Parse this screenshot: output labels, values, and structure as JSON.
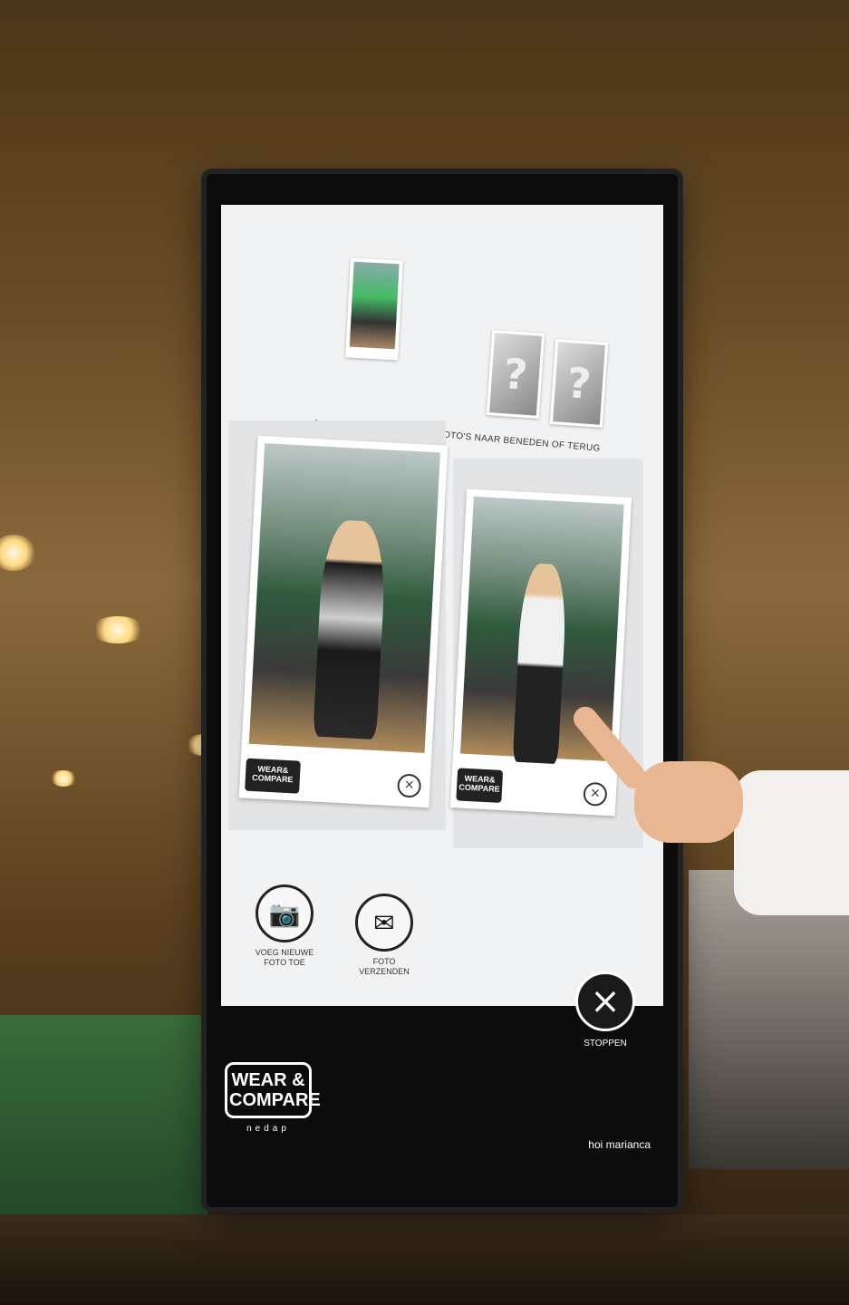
{
  "kiosk": {
    "instruction": "SLEEP MET JE VINGER DE FOTO'S NAAR BENEDEN OF TERUG",
    "actions": [
      {
        "label_line1": "VOEG NIEUWE",
        "label_line2": "FOTO TOE",
        "icon": "camera-icon"
      },
      {
        "label_line1": "FOTO",
        "label_line2": "VERZENDEN",
        "icon": "send-photo-icon"
      }
    ],
    "stop": {
      "label": "STOPPEN",
      "icon": "close-icon"
    },
    "card_logo": {
      "line1": "WEAR&",
      "line2": "COMPARE"
    },
    "brand": {
      "name_line1": "WEAR &",
      "name_line2": "COMPARE",
      "sub": "nedap"
    },
    "greeting": "hoi marianca",
    "placeholder_glyph": "?",
    "close_glyph": "×",
    "stop_glyph": "×"
  }
}
